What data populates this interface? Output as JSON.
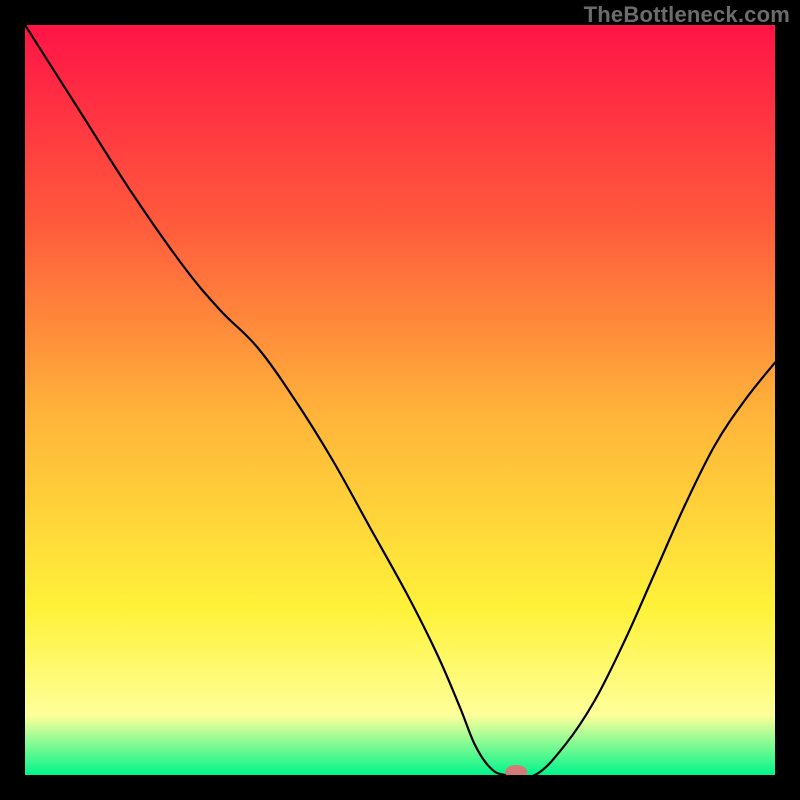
{
  "watermark": "TheBottleneck.com",
  "colors": {
    "grad_top": "#ff1447",
    "grad_q1": "#ff593c",
    "grad_mid": "#ffb43a",
    "grad_q3": "#fff23a",
    "grad_low": "#ffff9a",
    "grad_bot": "#00f58b",
    "frame": "#000000",
    "curve": "#000000",
    "marker": "#d47a7a"
  },
  "chart_data": {
    "type": "line",
    "title": "",
    "xlabel": "",
    "ylabel": "",
    "xlim": [
      0,
      100
    ],
    "ylim": [
      0,
      100
    ],
    "x": [
      0,
      7,
      14,
      21,
      26,
      31,
      36,
      41,
      46,
      51,
      55,
      58,
      60,
      62,
      64,
      68,
      72,
      76,
      80,
      84,
      88,
      92,
      96,
      100
    ],
    "y": [
      100,
      89,
      78,
      68,
      62,
      57,
      50,
      42,
      33,
      24,
      16,
      9,
      4,
      1,
      0,
      0,
      4,
      10,
      18,
      27,
      36,
      44,
      50,
      55
    ],
    "marker": {
      "x": 65.5,
      "y": 0
    },
    "note": "V-shaped bottleneck curve; left branch descends from top-left corner, flat minimum near x≈63–67, right branch rises to ~55% at right edge."
  }
}
